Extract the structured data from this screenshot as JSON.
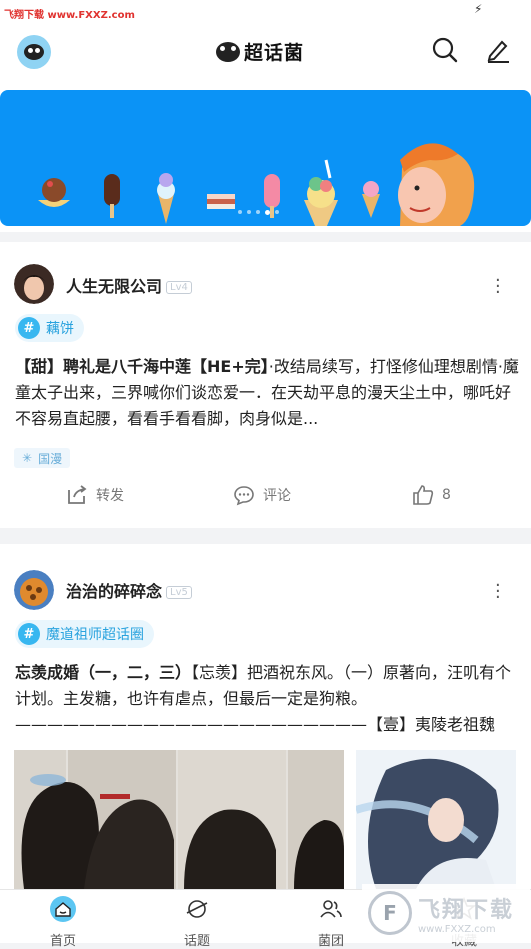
{
  "watermark_top": "飞翔下载 www.FXXZ.com",
  "header": {
    "title": "超话菌",
    "logo_icon": "bug-mascot-icon",
    "search_icon": "search-icon",
    "edit_icon": "edit-icon"
  },
  "banner": {
    "color": "#0b93f6",
    "page_count": 5,
    "active_index": 3
  },
  "posts": [
    {
      "user": "人生无限公司",
      "level": "Lv4",
      "topic": "藕饼",
      "title": "【甜】聘礼是八千海中莲【HE+完】",
      "body": "·改结局续写，打怪修仙理想剧情·魔童太子出来，三界喊你们谈恋爱一．在天劫平息的漫天尘土中，哪吒好不容易直起腰，看看手看看脚，肉身似是...",
      "tag": "国漫",
      "actions": {
        "repost": "转发",
        "comment": "评论",
        "like_count": "8"
      }
    },
    {
      "user": "治治的碎碎念",
      "level": "Lv5",
      "topic": "魔道祖师超话圈",
      "title": "忘羡成婚（一，二，三）",
      "body": "【忘羡】把酒祝东风。（一）原著向，汪叽有个计划。主发糖，也许有虐点，但最后一定是狗粮。——————————————————————【壹】夷陵老祖魏无..."
    }
  ],
  "tabbar": {
    "items": [
      "首页",
      "话题",
      "菌团",
      "收藏"
    ]
  },
  "watermark_bottom": {
    "big": "飞翔下载",
    "small": "www.FXXZ.com"
  }
}
